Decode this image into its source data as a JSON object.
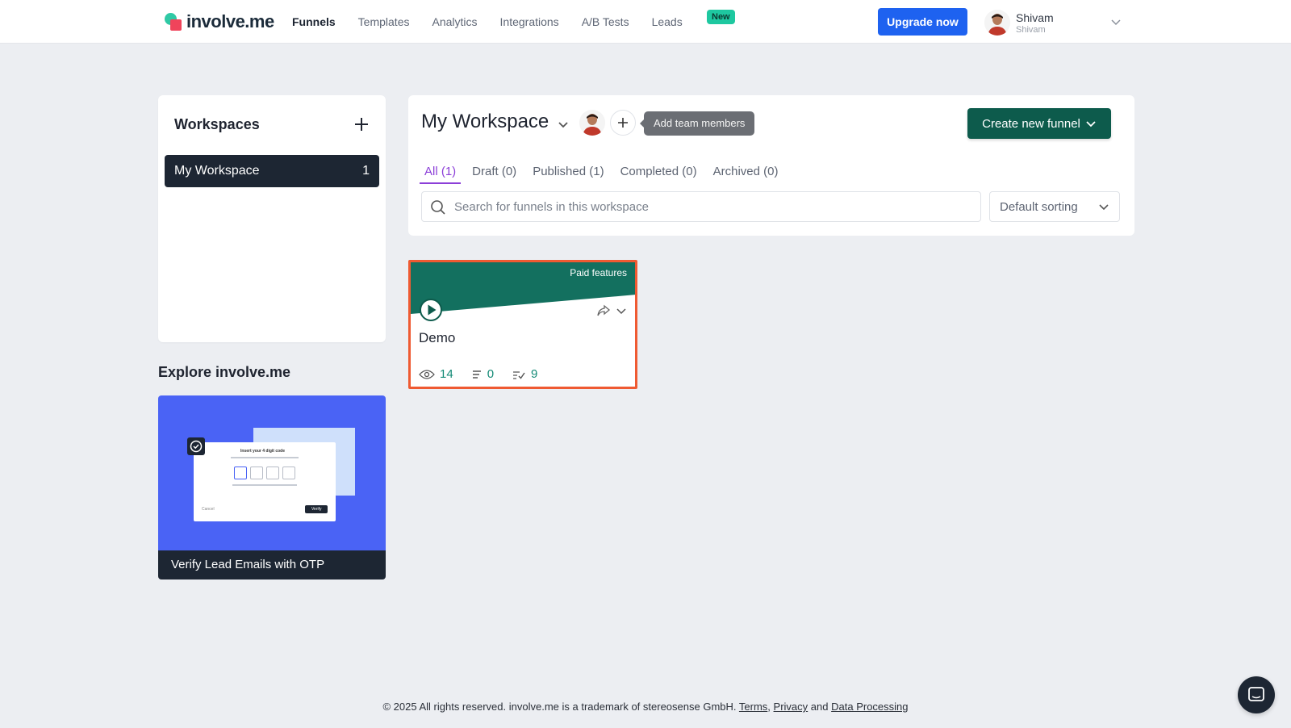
{
  "app": {
    "logo_text": "involve.me",
    "brand_colors": {
      "teal": "#2fc9a5",
      "red": "#f0445b",
      "dark_green": "#0d5b4c",
      "blue": "#1e62f0",
      "purple": "#8c3fd8",
      "orange": "#ef5a32"
    }
  },
  "nav": {
    "items": [
      {
        "label": "Funnels",
        "active": true
      },
      {
        "label": "Templates"
      },
      {
        "label": "Analytics"
      },
      {
        "label": "Integrations"
      },
      {
        "label": "A/B Tests"
      },
      {
        "label": "Leads"
      }
    ],
    "new_badge": "New",
    "upgrade_label": "Upgrade now"
  },
  "user": {
    "name": "Shivam",
    "subtitle": "Shivam"
  },
  "workspaces": {
    "title": "Workspaces",
    "items": [
      {
        "label": "My Workspace",
        "count": "1"
      }
    ]
  },
  "explore": {
    "title": "Explore involve.me",
    "card": {
      "caption": "Verify Lead Emails with OTP",
      "mock_heading": "Insert your 4 digit code",
      "mock_cancel": "Cancel",
      "mock_verify": "Verify"
    }
  },
  "main": {
    "workspace_title": "My Workspace",
    "tooltip": "Add team members",
    "create_label": "Create new funnel",
    "tabs": [
      {
        "label": "All (1)",
        "active": true
      },
      {
        "label": "Draft (0)"
      },
      {
        "label": "Published (1)"
      },
      {
        "label": "Completed (0)"
      },
      {
        "label": "Archived (0)"
      }
    ],
    "search_placeholder": "Search for funnels in this workspace",
    "sort_label": "Default sorting"
  },
  "funnel": {
    "paid_label": "Paid features",
    "name": "Demo",
    "views": "14",
    "responses": "0",
    "completions": "9"
  },
  "footer": {
    "text": "© 2025 All rights reserved. involve.me is a trademark of stereosense GmbH.",
    "terms": "Terms",
    "comma": ",",
    "privacy": "Privacy",
    "and": "and",
    "data_processing": "Data Processing"
  }
}
